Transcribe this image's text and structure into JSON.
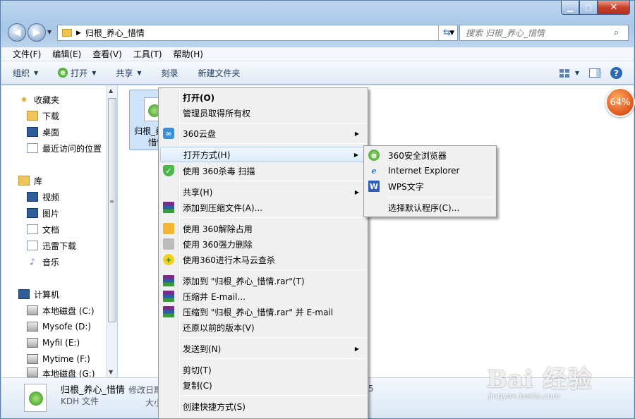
{
  "window": {
    "caption_buttons": {
      "min": "▁",
      "max": "□",
      "close": "✕"
    }
  },
  "nav": {
    "back_icon": "back-arrow-icon",
    "forward_icon": "forward-arrow-icon",
    "address_path": "归根_养心_惜情",
    "search_placeholder": "搜索 归根_养心_惜情"
  },
  "menubar": [
    "文件(F)",
    "编辑(E)",
    "查看(V)",
    "工具(T)",
    "帮助(H)"
  ],
  "toolbar": {
    "organize": "组织",
    "open": "打开",
    "share": "共享",
    "burn": "刻录",
    "new_folder": "新建文件夹"
  },
  "sidebar": {
    "favorites": {
      "title": "收藏夹",
      "items": [
        "下载",
        "桌面",
        "最近访问的位置"
      ]
    },
    "libraries": {
      "title": "库",
      "items": [
        "视频",
        "图片",
        "文档",
        "迅雷下载",
        "音乐"
      ]
    },
    "computer": {
      "title": "计算机",
      "items": [
        "本地磁盘 (C:)",
        "Mysofe (D:)",
        "Myfil (E:)",
        "Mytime (F:)",
        "本地磁盘 (G:)"
      ]
    }
  },
  "file": {
    "name_line1": "归根_养",
    "name_line2": "惜情"
  },
  "speed_badge": "64%",
  "context_menu": {
    "items": [
      {
        "label": "打开(O)",
        "bold": true
      },
      {
        "label": "管理员取得所有权"
      },
      {
        "label": "360云盘",
        "submenu": true,
        "icon": "cloud-icon"
      },
      {
        "label": "打开方式(H)",
        "submenu": true,
        "highlight": true
      },
      {
        "label": "使用 360杀毒 扫描",
        "icon": "shield-icon"
      },
      {
        "label": "共享(H)",
        "submenu": true
      },
      {
        "label": "添加到压缩文件(A)...",
        "icon": "winrar-icon"
      },
      {
        "label": "使用 360解除占用",
        "icon": "unlock-icon"
      },
      {
        "label": "使用 360强力删除",
        "icon": "shredder-icon"
      },
      {
        "label": "使用360进行木马云查杀",
        "icon": "trojan-scan-icon"
      },
      {
        "label": "添加到 \"归根_养心_惜情.rar\"(T)",
        "icon": "winrar-icon"
      },
      {
        "label": "压缩并 E-mail...",
        "icon": "winrar-icon"
      },
      {
        "label": "压缩到 \"归根_养心_惜情.rar\" 并 E-mail",
        "icon": "winrar-icon"
      },
      {
        "label": "还原以前的版本(V)"
      },
      {
        "label": "发送到(N)",
        "submenu": true
      },
      {
        "label": "剪切(T)"
      },
      {
        "label": "复制(C)"
      },
      {
        "label": "创建快捷方式(S)"
      }
    ]
  },
  "open_with_menu": {
    "items": [
      "360安全浏览器",
      "Internet Explorer",
      "WPS文字",
      "选择默认程序(C)..."
    ]
  },
  "details": {
    "name": "归根_养心_惜情",
    "modified_label": "修改日期",
    "type": "KDH 文件",
    "size_label": "大小",
    "modified_value": "5"
  },
  "watermark": {
    "line1": "Bai 经验",
    "line2": "jingyan.baidu.com"
  }
}
